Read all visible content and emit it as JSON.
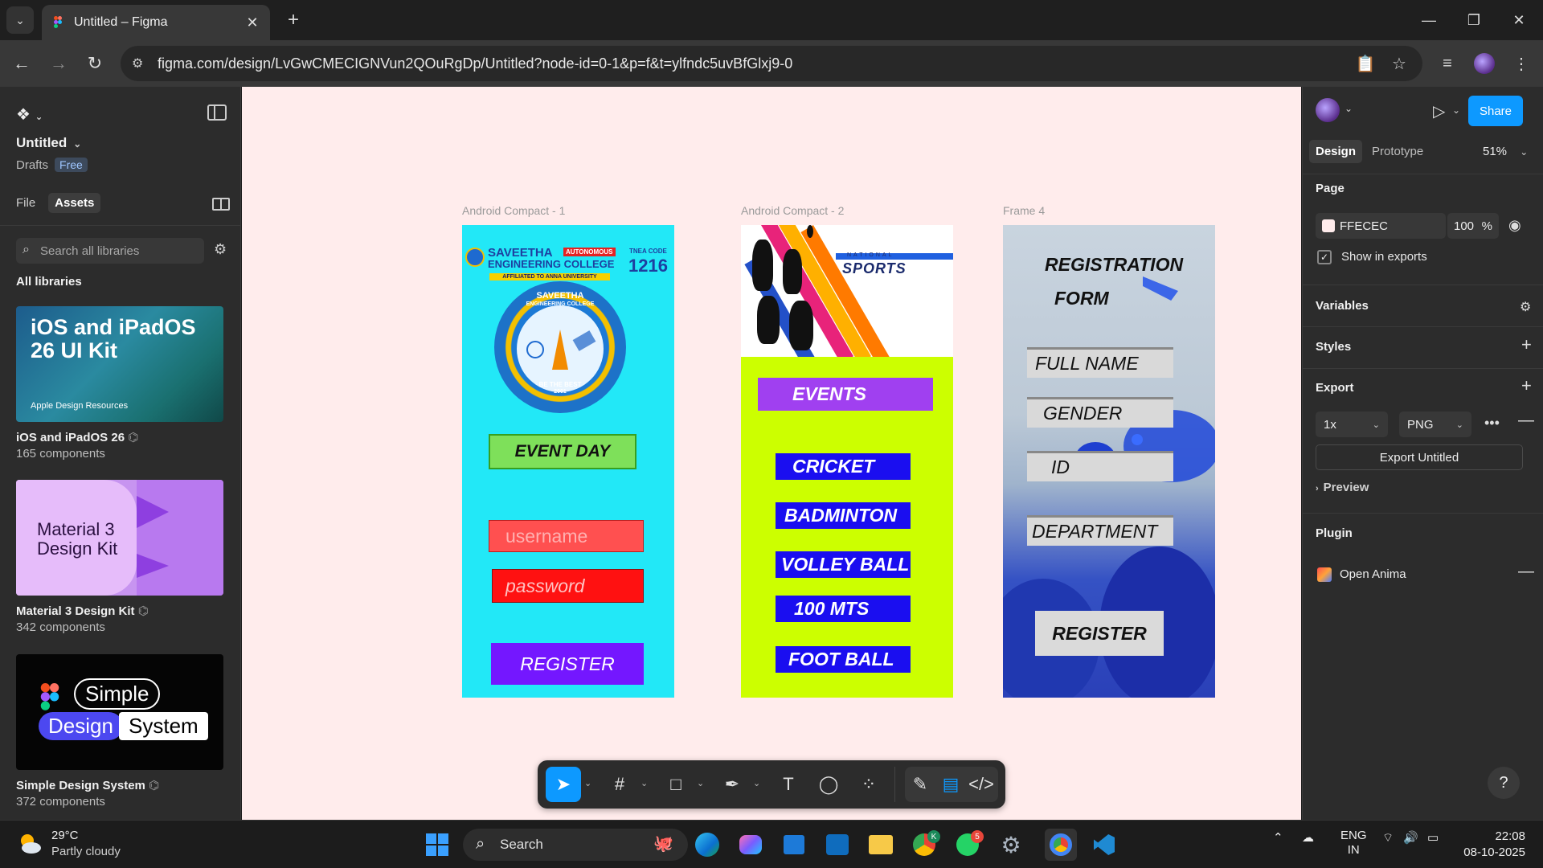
{
  "browser": {
    "tab_title": "Untitled – Figma",
    "url": "figma.com/design/LvGwCMECIGNVun2QOuRgDp/Untitled?node-id=0-1&p=f&t=ylfndc5uvBfGlxj9-0"
  },
  "left_panel": {
    "file_title": "Untitled",
    "drafts_label": "Drafts",
    "plan_badge": "Free",
    "tabs": [
      "File",
      "Assets"
    ],
    "active_tab": "Assets",
    "search_placeholder": "Search all libraries",
    "all_libraries_label": "All libraries",
    "libraries": [
      {
        "name": "iOS and iPadOS 26",
        "count": "165 components",
        "cover_title": "iOS and iPadOS 26 UI Kit",
        "cover_sub": "Apple Design Resources"
      },
      {
        "name": "Material 3 Design Kit",
        "count": "342 components",
        "cover_title_1": "Material 3",
        "cover_title_2": "Design Kit"
      },
      {
        "name": "Simple Design System",
        "count": "372 components",
        "cover_words": [
          "Simple",
          "Design",
          "System"
        ]
      }
    ]
  },
  "canvas": {
    "background": "#ffecec",
    "frames": [
      {
        "label": "Android Compact - 1",
        "college_name_1": "SAVEETHA",
        "college_name_2": "ENGINEERING COLLEGE",
        "autonomous": "AUTONOMOUS",
        "affiliated": "AFFILIATED TO ANNA UNIVERSITY",
        "tnea_label": "TNEA CODE",
        "tnea_code": "1216",
        "emblem_top_1": "SAVEETHA",
        "emblem_top_2": "ENGINEERING COLLEGE",
        "emblem_bottom_1": "BE THE BEST",
        "emblem_bottom_2": "2001",
        "event_day": "EVENT DAY",
        "username_placeholder": "username",
        "password_placeholder": "password",
        "register": "REGISTER"
      },
      {
        "label": "Android Compact - 2",
        "banner_national": "NATIONAL",
        "banner_title": "SPORTS",
        "events_header": "EVENTS",
        "events": [
          "CRICKET",
          "BADMINTON",
          "VOLLEY BALL",
          "100 MTS",
          "FOOT BALL"
        ]
      },
      {
        "label": "Frame 4",
        "title_1": "REGISTRATION",
        "title_2": "FORM",
        "fields": [
          "FULL NAME",
          "GENDER",
          "ID",
          "DEPARTMENT"
        ],
        "register": "REGISTER"
      }
    ]
  },
  "right_panel": {
    "share_label": "Share",
    "tabs": [
      "Design",
      "Prototype"
    ],
    "active_tab": "Design",
    "zoom": "51%",
    "page_section": "Page",
    "page_color": "FFECEC",
    "page_opacity": "100",
    "page_opacity_unit": "%",
    "show_in_exports": "Show in exports",
    "show_in_exports_checked": true,
    "variables": "Variables",
    "styles": "Styles",
    "export_section": "Export",
    "export_scale": "1x",
    "export_format": "PNG",
    "export_button": "Export Untitled",
    "preview": "Preview",
    "plugin_section": "Plugin",
    "plugin_name": "Open Anima",
    "help": "?"
  },
  "taskbar": {
    "temperature": "29°C",
    "weather": "Partly cloudy",
    "search": "Search",
    "whatsapp_badge": "5",
    "chrome_badge": "K",
    "lang_1": "ENG",
    "lang_2": "IN",
    "time": "22:08",
    "date": "08-10-2025"
  }
}
